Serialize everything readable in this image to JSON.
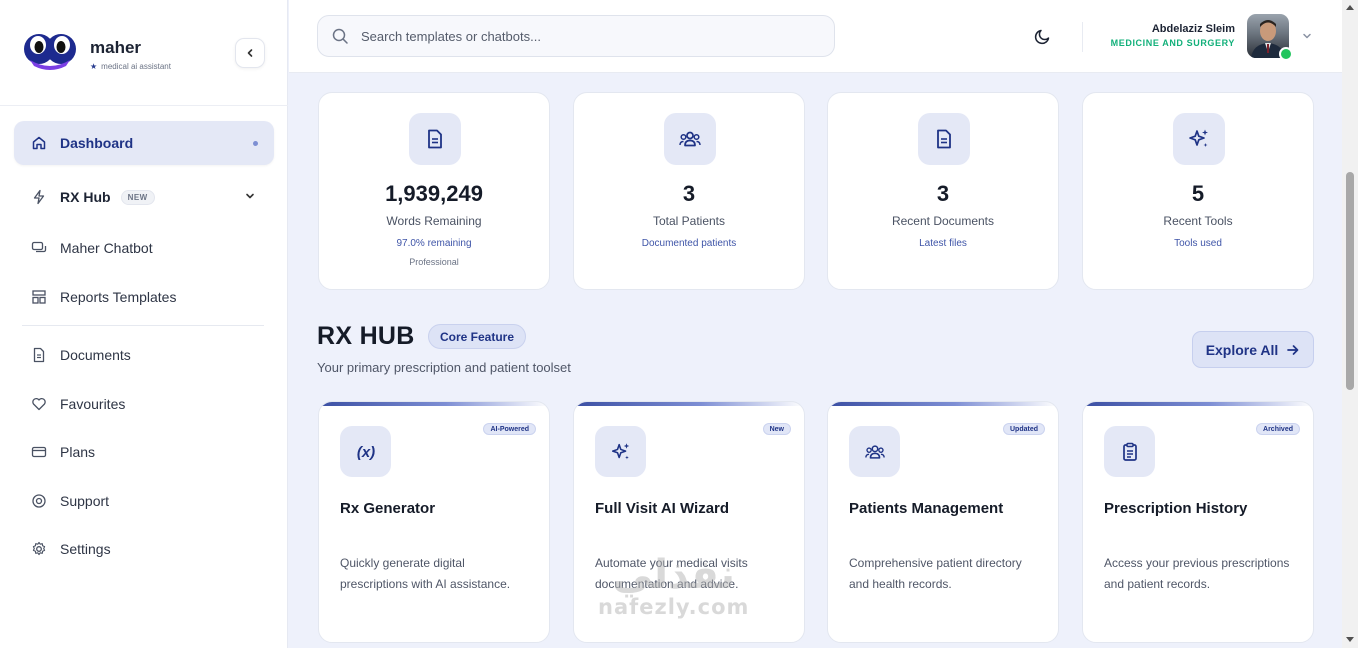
{
  "brand": {
    "name": "maher",
    "tagline": "medical ai assistant"
  },
  "sidebar": {
    "items": [
      {
        "label": "Dashboard",
        "icon": "home-icon"
      },
      {
        "label": "RX Hub",
        "badge": "NEW",
        "icon": "lightning-icon"
      },
      {
        "label": "Maher Chatbot",
        "icon": "chat-icon"
      },
      {
        "label": "Reports Templates",
        "icon": "layout-icon"
      },
      {
        "label": "Documents",
        "icon": "document-icon"
      },
      {
        "label": "Favourites",
        "icon": "heart-icon"
      },
      {
        "label": "Plans",
        "icon": "credit-card-icon"
      },
      {
        "label": "Support",
        "icon": "lifebuoy-icon"
      },
      {
        "label": "Settings",
        "icon": "gear-icon"
      }
    ]
  },
  "topbar": {
    "search_placeholder": "Search templates or chatbots...",
    "user": {
      "name": "Abdelaziz Sleim",
      "role": "MEDICINE AND SURGERY"
    }
  },
  "stats": [
    {
      "value": "1,939,249",
      "label": "Words Remaining",
      "sub": "97.0% remaining",
      "sub2": "Professional",
      "icon": "document-icon"
    },
    {
      "value": "3",
      "label": "Total Patients",
      "sub": "Documented patients",
      "icon": "users-icon"
    },
    {
      "value": "3",
      "label": "Recent Documents",
      "sub": "Latest files",
      "icon": "document-icon"
    },
    {
      "value": "5",
      "label": "Recent Tools",
      "sub": "Tools used",
      "icon": "sparkles-icon"
    }
  ],
  "rxhub": {
    "title": "RX HUB",
    "badge": "Core Feature",
    "subtitle": "Your primary prescription and patient toolset",
    "explore_label": "Explore All",
    "cards": [
      {
        "title": "Rx Generator",
        "tag": "AI-Powered",
        "desc": "Quickly generate digital prescriptions with AI assistance.",
        "icon": "function-icon"
      },
      {
        "title": "Full Visit AI Wizard",
        "tag": "New",
        "desc": "Automate your medical visits documentation and advice.",
        "icon": "sparkles-icon"
      },
      {
        "title": "Patients Management",
        "tag": "Updated",
        "desc": "Comprehensive patient directory and health records.",
        "icon": "users-icon"
      },
      {
        "title": "Prescription History",
        "tag": "Archived",
        "desc": "Access your previous prescriptions and patient records.",
        "icon": "clipboard-icon"
      }
    ]
  },
  "watermark": {
    "arabic": "نفذلي",
    "latin": "nafezly.com"
  },
  "colors": {
    "accent": "#1f3386",
    "accent_soft": "#e4e8f6",
    "online": "#22c55e",
    "role": "#12b07a"
  }
}
